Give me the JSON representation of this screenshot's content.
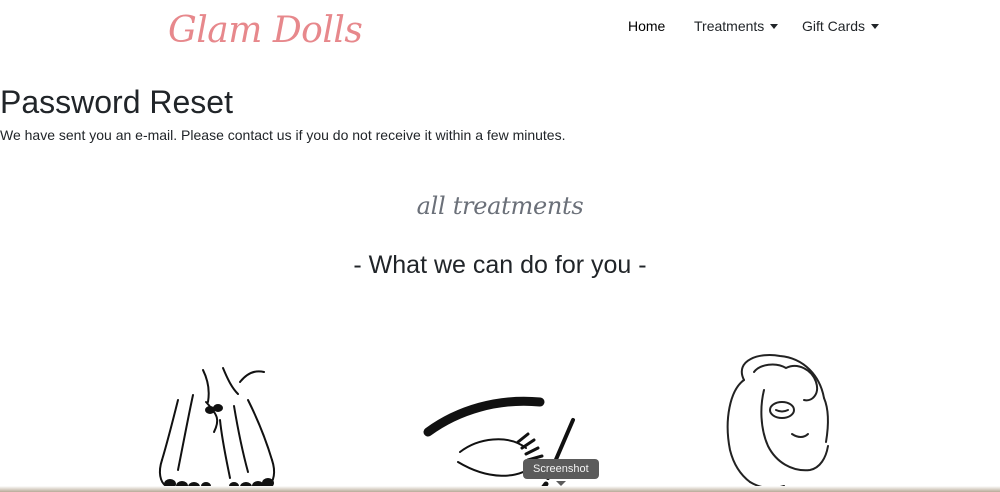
{
  "brand": {
    "logo_text": "Glam Dolls",
    "accent_color": "#e7888c"
  },
  "nav": {
    "items": [
      {
        "label": "Home",
        "has_dropdown": false
      },
      {
        "label": "Treatments",
        "has_dropdown": true
      },
      {
        "label": "Gift Cards",
        "has_dropdown": true
      }
    ]
  },
  "main": {
    "title": "Password Reset",
    "message": "We have sent you an e-mail. Please contact us if you do not receive it within a few minutes."
  },
  "treatments_section": {
    "script_heading": "all treatments",
    "heading": "- What we can do for you -",
    "illustrations": [
      "feet-pedicure-illustration",
      "eye-lashes-illustration",
      "face-mask-illustration"
    ]
  },
  "tooltip": {
    "text": "Screenshot"
  }
}
